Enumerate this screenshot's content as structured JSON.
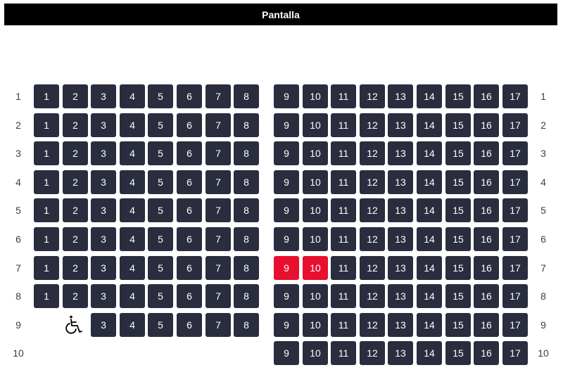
{
  "screen": {
    "label": "Pantalla"
  },
  "colors": {
    "seat_available": "#2a2d3e",
    "seat_selected": "#e8102e",
    "screen_bar": "#000000"
  },
  "icons": {
    "accessible_seat": "wheelchair-icon"
  },
  "rows": [
    {
      "label": "1",
      "left": [
        "1",
        "2",
        "3",
        "4",
        "5",
        "6",
        "7",
        "8"
      ],
      "right": [
        "9",
        "10",
        "11",
        "12",
        "13",
        "14",
        "15",
        "16",
        "17"
      ],
      "selected": []
    },
    {
      "label": "2",
      "left": [
        "1",
        "2",
        "3",
        "4",
        "5",
        "6",
        "7",
        "8"
      ],
      "right": [
        "9",
        "10",
        "11",
        "12",
        "13",
        "14",
        "15",
        "16",
        "17"
      ],
      "selected": []
    },
    {
      "label": "3",
      "left": [
        "1",
        "2",
        "3",
        "4",
        "5",
        "6",
        "7",
        "8"
      ],
      "right": [
        "9",
        "10",
        "11",
        "12",
        "13",
        "14",
        "15",
        "16",
        "17"
      ],
      "selected": []
    },
    {
      "label": "4",
      "left": [
        "1",
        "2",
        "3",
        "4",
        "5",
        "6",
        "7",
        "8"
      ],
      "right": [
        "9",
        "10",
        "11",
        "12",
        "13",
        "14",
        "15",
        "16",
        "17"
      ],
      "selected": []
    },
    {
      "label": "5",
      "left": [
        "1",
        "2",
        "3",
        "4",
        "5",
        "6",
        "7",
        "8"
      ],
      "right": [
        "9",
        "10",
        "11",
        "12",
        "13",
        "14",
        "15",
        "16",
        "17"
      ],
      "selected": []
    },
    {
      "label": "6",
      "left": [
        "1",
        "2",
        "3",
        "4",
        "5",
        "6",
        "7",
        "8"
      ],
      "right": [
        "9",
        "10",
        "11",
        "12",
        "13",
        "14",
        "15",
        "16",
        "17"
      ],
      "selected": []
    },
    {
      "label": "7",
      "left": [
        "1",
        "2",
        "3",
        "4",
        "5",
        "6",
        "7",
        "8"
      ],
      "right": [
        "9",
        "10",
        "11",
        "12",
        "13",
        "14",
        "15",
        "16",
        "17"
      ],
      "selected": [
        "9",
        "10"
      ]
    },
    {
      "label": "8",
      "left": [
        "1",
        "2",
        "3",
        "4",
        "5",
        "6",
        "7",
        "8"
      ],
      "right": [
        "9",
        "10",
        "11",
        "12",
        "13",
        "14",
        "15",
        "16",
        "17"
      ],
      "selected": []
    },
    {
      "label": "9",
      "left": [
        "3",
        "4",
        "5",
        "6",
        "7",
        "8"
      ],
      "accessible": true,
      "right": [
        "9",
        "10",
        "11",
        "12",
        "13",
        "14",
        "15",
        "16",
        "17"
      ],
      "selected": []
    },
    {
      "label": "10",
      "left": [],
      "right": [
        "9",
        "10",
        "11",
        "12",
        "13",
        "14",
        "15",
        "16",
        "17"
      ],
      "selected": []
    }
  ]
}
